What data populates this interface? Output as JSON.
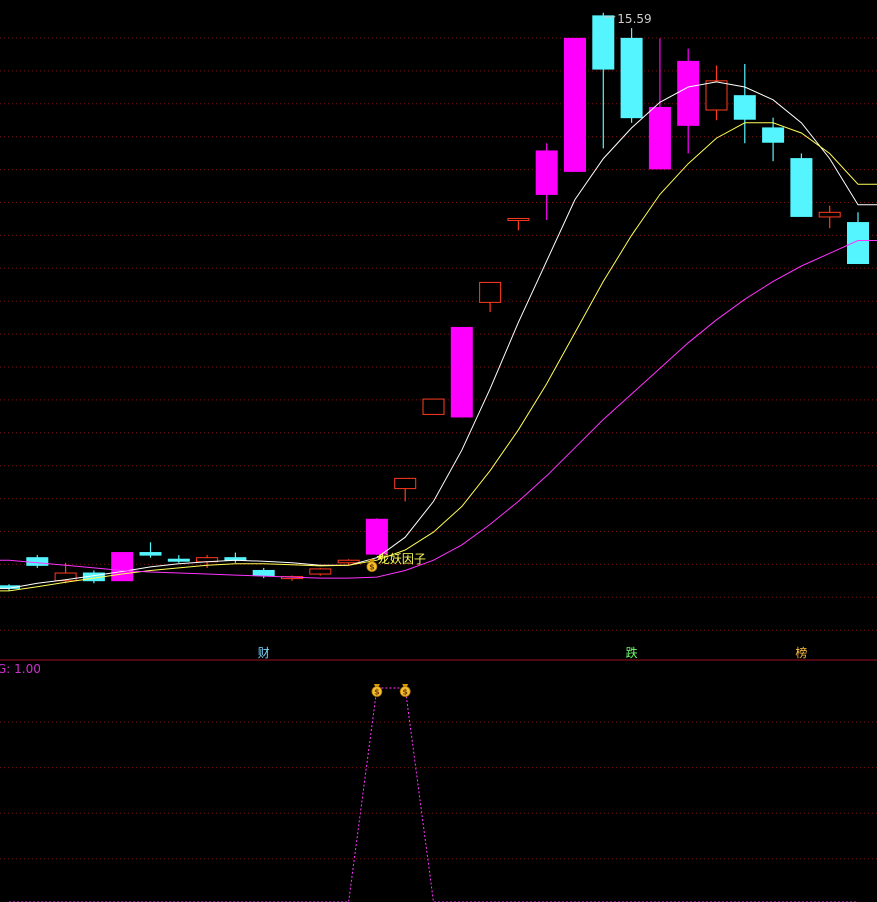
{
  "colors": {
    "background": "#000000",
    "grid": "#7a1010",
    "divider": "#a01020",
    "up_candle": "#ff00ff",
    "up_hollow": "#ff3b1f",
    "down_candle": "#55f5ff",
    "ma_white": "#ffffff",
    "ma_yellow": "#ffff55",
    "ma_magenta": "#ff33ff",
    "signal_line": "#ff33ff",
    "label_text": "#ffff55",
    "status_text": "#cc33cc"
  },
  "top_panel": {
    "max_price_label": "15.59",
    "signal_label": "龙妖因子",
    "markers": [
      {
        "text": "财",
        "index": 9,
        "color": "#7fd7ff"
      },
      {
        "text": "跌",
        "index": 22,
        "color": "#6fff6f"
      },
      {
        "text": "榜",
        "index": 28,
        "color": "#ffc040"
      }
    ]
  },
  "bottom_panel": {
    "status_text": "G: 1.00",
    "icons": [
      {
        "name": "money-bag-icon",
        "index": 13
      },
      {
        "name": "money-bag-icon",
        "index": 14
      }
    ]
  },
  "chart_data": [
    {
      "type": "candlestick",
      "title": "",
      "ylim": [
        3.0,
        15.9
      ],
      "candles": [
        {
          "open": 4.45,
          "close": 4.4,
          "high": 4.48,
          "low": 4.35
        },
        {
          "open": 5.0,
          "close": 4.85,
          "high": 5.05,
          "low": 4.8
        },
        {
          "open": 4.55,
          "close": 4.7,
          "high": 4.9,
          "low": 4.5
        },
        {
          "open": 4.7,
          "close": 4.55,
          "high": 4.75,
          "low": 4.5
        },
        {
          "open": 4.55,
          "close": 5.1,
          "high": 5.1,
          "low": 4.55
        },
        {
          "open": 5.1,
          "close": 5.05,
          "high": 5.3,
          "low": 5.0
        },
        {
          "open": 4.97,
          "close": 4.95,
          "high": 5.05,
          "low": 4.9
        },
        {
          "open": 4.92,
          "close": 5.0,
          "high": 5.05,
          "low": 4.8
        },
        {
          "open": 5.0,
          "close": 4.95,
          "high": 5.1,
          "low": 4.9
        },
        {
          "open": 4.75,
          "close": 4.65,
          "high": 4.8,
          "low": 4.6
        },
        {
          "open": 4.6,
          "close": 4.63,
          "high": 4.65,
          "low": 4.55
        },
        {
          "open": 4.68,
          "close": 4.78,
          "high": 4.8,
          "low": 4.65
        },
        {
          "open": 4.9,
          "close": 4.95,
          "high": 4.97,
          "low": 4.85
        },
        {
          "open": 5.07,
          "close": 5.75,
          "high": 5.77,
          "low": 5.05
        },
        {
          "open": 6.35,
          "close": 6.55,
          "high": 6.55,
          "low": 6.1
        },
        {
          "open": 7.8,
          "close": 8.1,
          "high": 8.1,
          "low": 7.8
        },
        {
          "open": 7.75,
          "close": 9.5,
          "high": 9.5,
          "low": 7.75
        },
        {
          "open": 9.99,
          "close": 10.38,
          "high": 10.38,
          "low": 9.8
        },
        {
          "open": 11.6,
          "close": 11.63,
          "high": 11.63,
          "low": 11.4
        },
        {
          "open": 12.1,
          "close": 12.95,
          "high": 13.1,
          "low": 11.6
        },
        {
          "open": 12.55,
          "close": 15.15,
          "high": 15.15,
          "low": 12.55
        },
        {
          "open": 15.59,
          "close": 14.55,
          "high": 15.65,
          "low": 13.0
        },
        {
          "open": 15.15,
          "close": 13.6,
          "high": 15.35,
          "low": 13.5
        },
        {
          "open": 12.6,
          "close": 13.8,
          "high": 15.15,
          "low": 12.6
        },
        {
          "open": 13.45,
          "close": 14.7,
          "high": 14.95,
          "low": 12.9
        },
        {
          "open": 13.75,
          "close": 14.32,
          "high": 14.62,
          "low": 13.55
        },
        {
          "open": 14.03,
          "close": 13.57,
          "high": 14.65,
          "low": 13.1
        },
        {
          "open": 13.4,
          "close": 13.12,
          "high": 13.6,
          "low": 12.75
        },
        {
          "open": 12.8,
          "close": 11.67,
          "high": 12.9,
          "low": 11.67
        },
        {
          "open": 11.66,
          "close": 11.75,
          "high": 11.88,
          "low": 11.44
        },
        {
          "open": 11.55,
          "close": 10.75,
          "high": 11.75,
          "low": 10.75
        }
      ],
      "ma_white": [
        4.4,
        4.5,
        4.57,
        4.65,
        4.73,
        4.82,
        4.88,
        4.92,
        4.95,
        4.93,
        4.9,
        4.85,
        4.85,
        5.0,
        5.4,
        6.1,
        7.1,
        8.3,
        9.6,
        10.8,
        12.0,
        12.8,
        13.4,
        13.9,
        14.2,
        14.3,
        14.2,
        13.95,
        13.5,
        12.8,
        11.9
      ],
      "ma_yellow": [
        4.35,
        4.43,
        4.52,
        4.6,
        4.68,
        4.75,
        4.8,
        4.85,
        4.88,
        4.88,
        4.86,
        4.84,
        4.85,
        4.95,
        5.15,
        5.5,
        6.0,
        6.7,
        7.5,
        8.4,
        9.4,
        10.4,
        11.3,
        12.1,
        12.7,
        13.2,
        13.5,
        13.5,
        13.3,
        12.9,
        12.3
      ],
      "ma_magenta": [
        4.95,
        4.9,
        4.85,
        4.8,
        4.75,
        4.72,
        4.7,
        4.68,
        4.66,
        4.64,
        4.62,
        4.6,
        4.6,
        4.62,
        4.75,
        4.95,
        5.25,
        5.65,
        6.1,
        6.6,
        7.15,
        7.7,
        8.2,
        8.7,
        9.2,
        9.65,
        10.05,
        10.4,
        10.7,
        10.95,
        11.2
      ],
      "signal_index": 13
    },
    {
      "type": "line",
      "title": "",
      "ylim": [
        0,
        1
      ],
      "values": [
        0,
        0,
        0,
        0,
        0,
        0,
        0,
        0,
        0,
        0,
        0,
        0,
        0,
        1,
        1,
        0,
        0,
        0,
        0,
        0,
        0,
        0,
        0,
        0,
        0,
        0,
        0,
        0,
        0,
        0,
        0
      ]
    }
  ]
}
